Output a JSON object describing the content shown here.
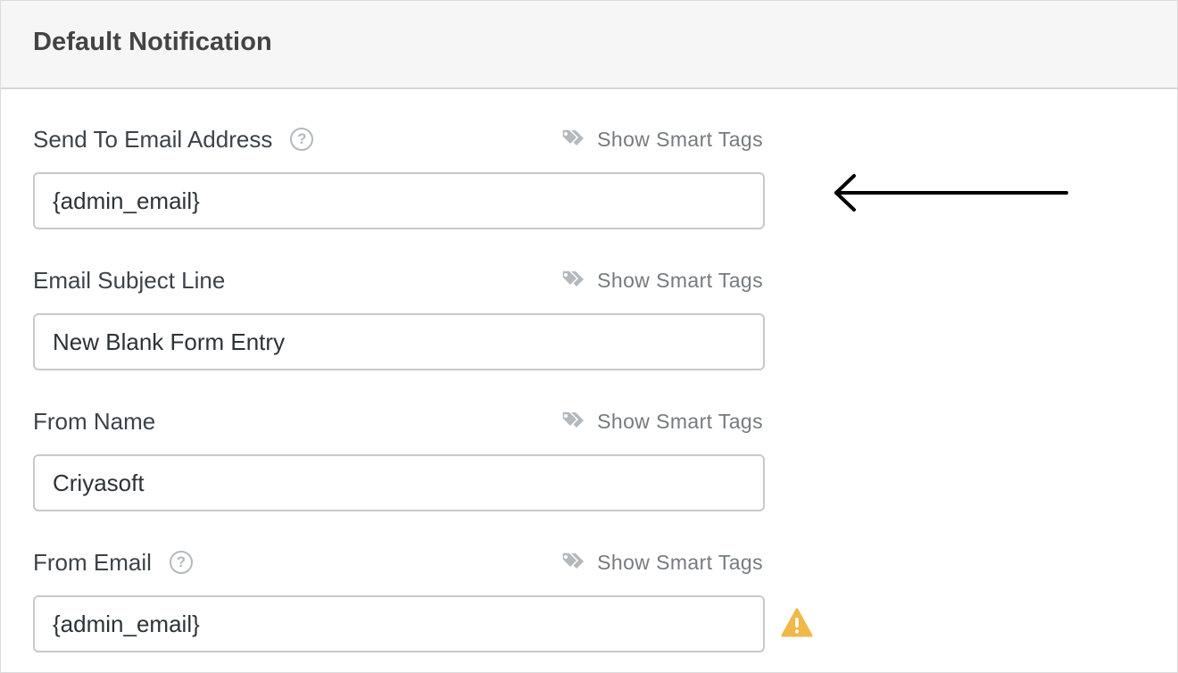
{
  "panel": {
    "title": "Default Notification"
  },
  "fields": [
    {
      "label": "Send To Email Address",
      "value": "{admin_email}",
      "smart_tags": "Show Smart Tags",
      "has_help": true
    },
    {
      "label": "Email Subject Line",
      "value": "New Blank Form Entry",
      "smart_tags": "Show Smart Tags",
      "has_help": false
    },
    {
      "label": "From Name",
      "value": "Criyasoft",
      "smart_tags": "Show Smart Tags",
      "has_help": false
    },
    {
      "label": "From Email",
      "value": "{admin_email}",
      "smart_tags": "Show Smart Tags",
      "has_help": true
    }
  ],
  "icons": {
    "help": "question-mark-icon",
    "smart_tags": "tag-icon",
    "annotation": "left-arrow-icon",
    "warning": "warning-icon"
  },
  "help_glyph": "?",
  "colors": {
    "header_bg": "#f6f6f6",
    "warning": "#f0b849",
    "muted": "#757b80"
  }
}
